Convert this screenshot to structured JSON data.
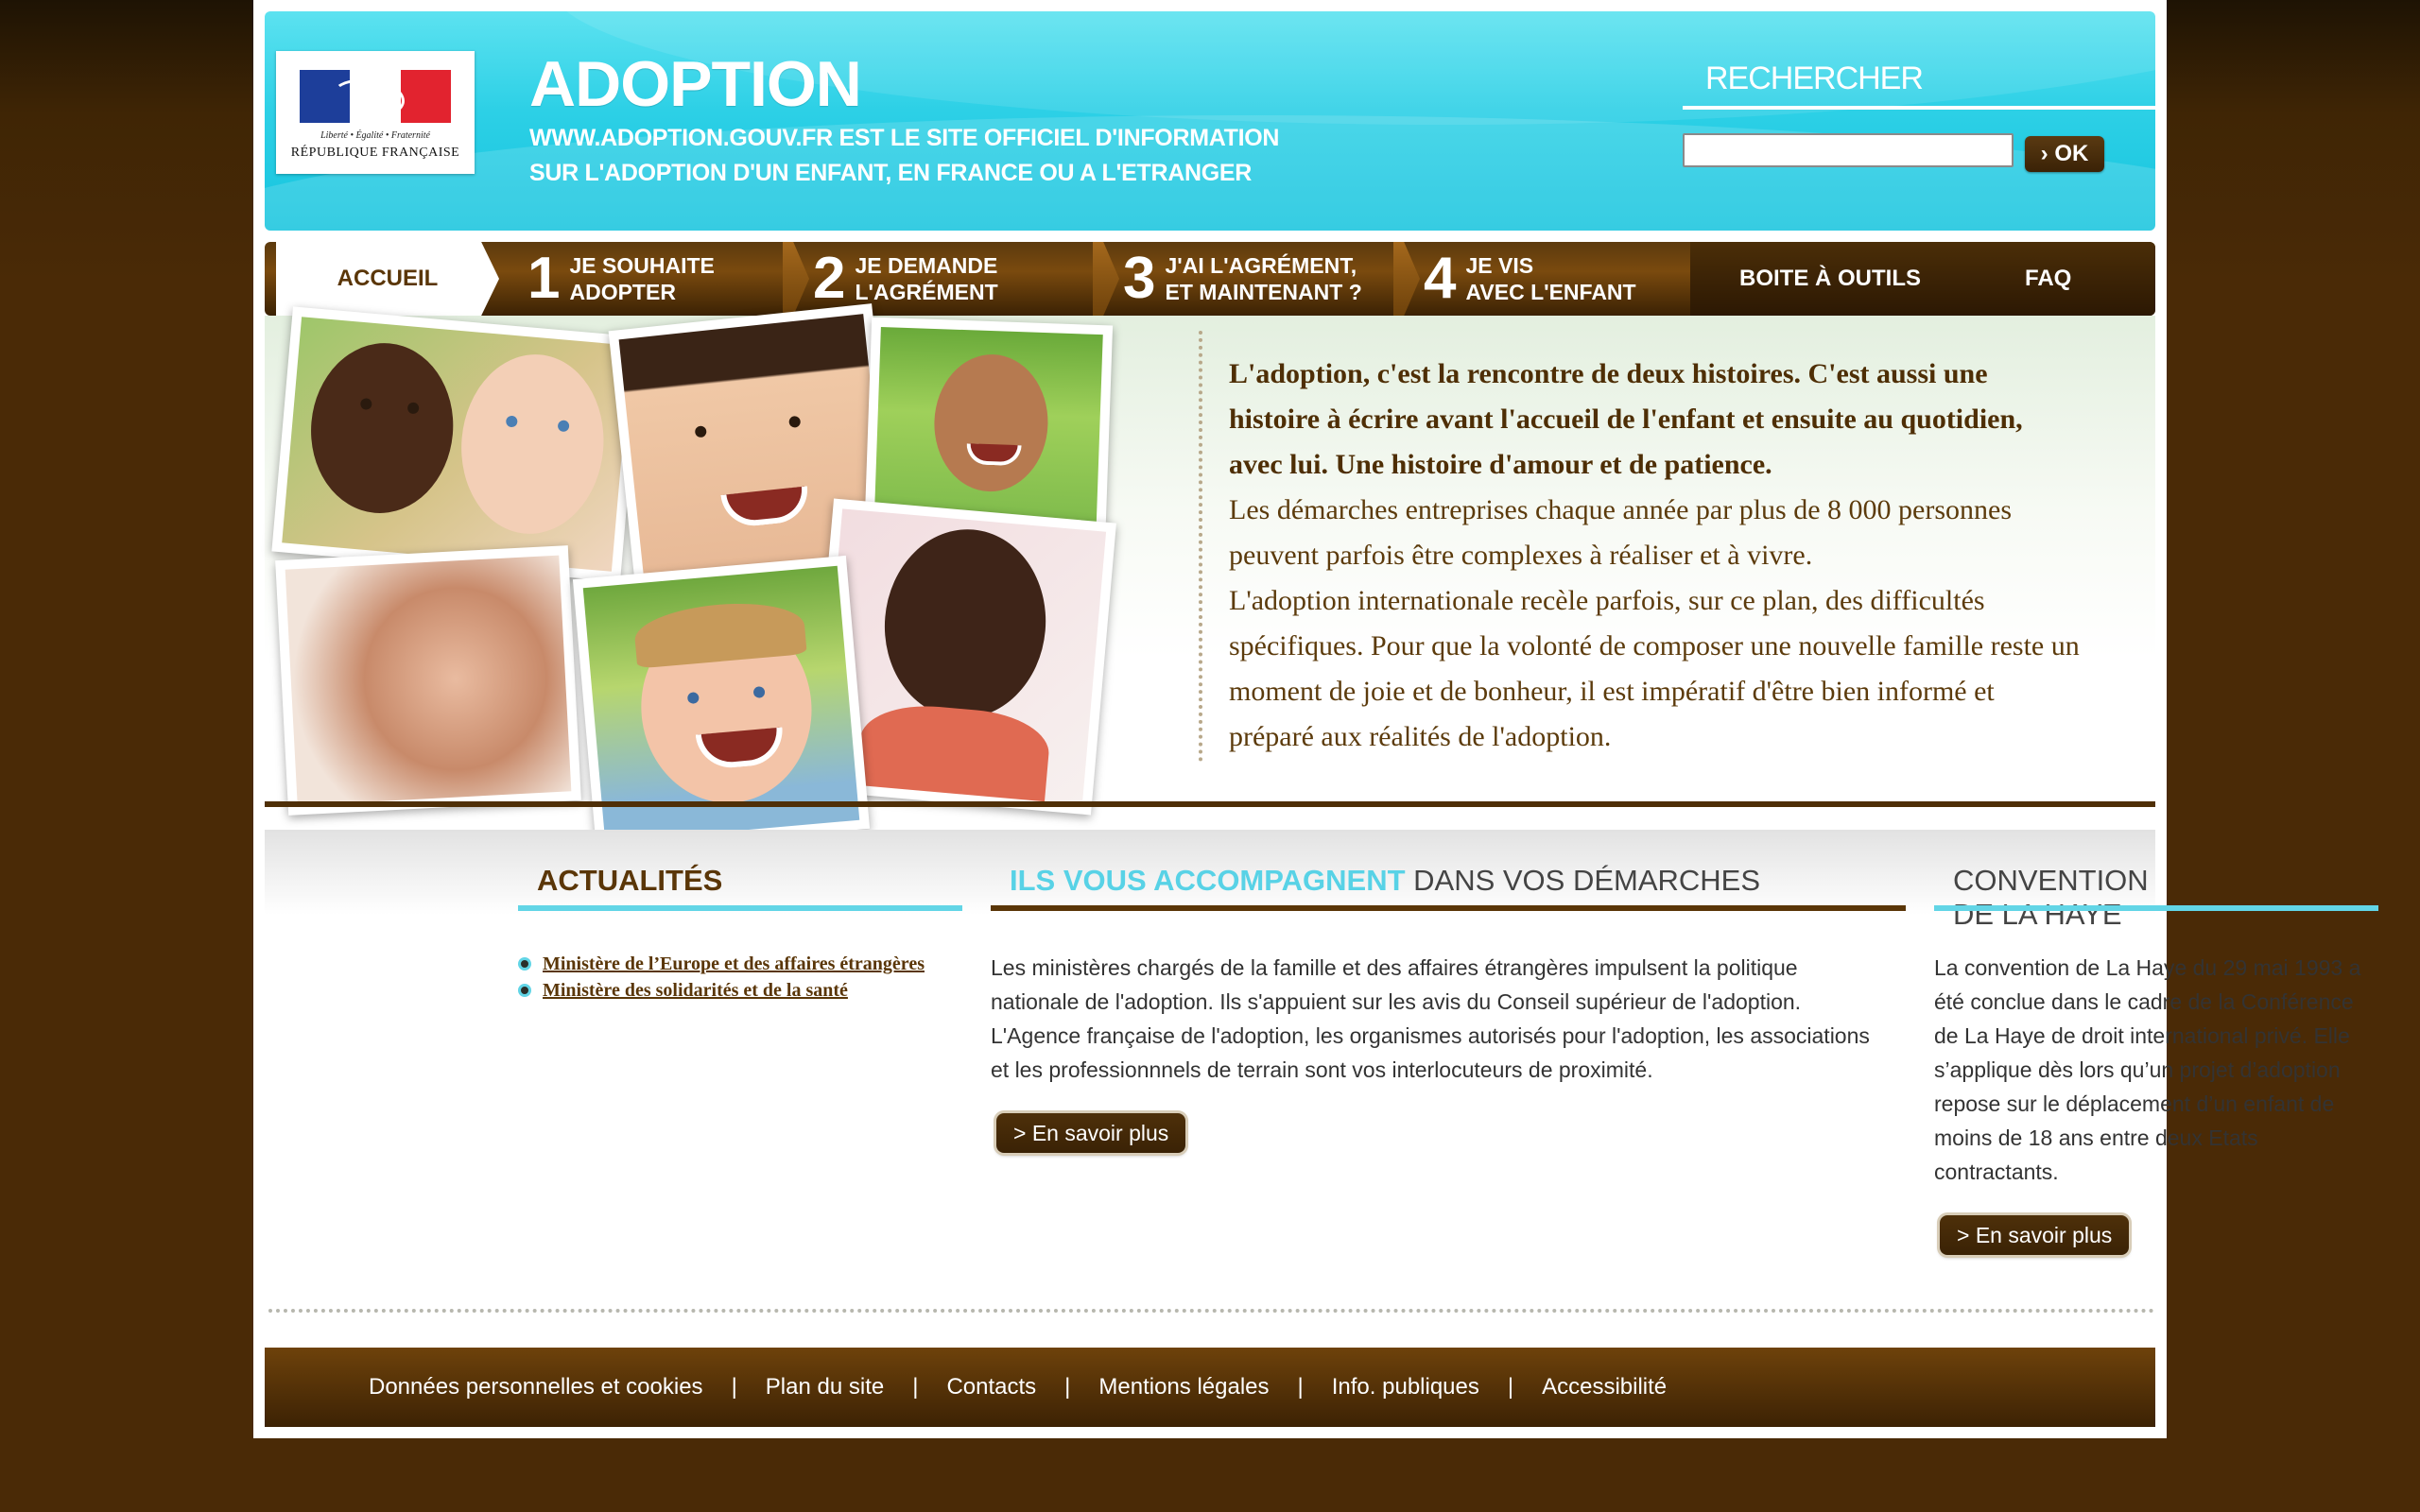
{
  "header": {
    "logo_motto": "Liberté • Égalité • Fraternité",
    "logo_republic": "RÉPUBLIQUE FRANÇAISE",
    "title": "ADOPTION",
    "subtitle_line1": "WWW.ADOPTION.GOUV.FR EST LE SITE OFFICIEL D'INFORMATION",
    "subtitle_line2": "SUR L'ADOPTION D'UN ENFANT, EN FRANCE OU A L'ETRANGER",
    "search_title": "RECHERCHER",
    "search_value": "",
    "search_ok": "› OK"
  },
  "nav": {
    "home": "ACCUEIL",
    "steps": [
      {
        "num": "1",
        "label": "JE SOUHAITE\nADOPTER"
      },
      {
        "num": "2",
        "label": "JE DEMANDE\nL'AGRÉMENT"
      },
      {
        "num": "3",
        "label": "J'AI L'AGRÉMENT,\nET MAINTENANT ?"
      },
      {
        "num": "4",
        "label": "JE VIS\nAVEC L'ENFANT"
      }
    ],
    "tools": "BOITE À OUTILS",
    "faq": "FAQ"
  },
  "intro": {
    "lead": "L'adoption, c'est la rencontre de deux histoires. C'est aussi une histoire à écrire avant l'accueil de l'enfant et ensuite au quotidien, avec lui. Une histoire d'amour et de patience.",
    "p1": "Les démarches entreprises chaque année par plus de 8 000 personnes peuvent parfois être complexes à réaliser et à vivre.",
    "p2": "L'adoption internationale recèle parfois, sur ce plan, des difficultés spécifiques. Pour que la volonté de composer une nouvelle famille reste un moment de joie et de bonheur, il est impératif d'être bien informé et préparé aux réalités de l'adoption."
  },
  "news": {
    "title": "ACTUALITÉS",
    "links": [
      "Ministère de l’Europe et des affaires étrangères",
      "Ministère des solidarités et de la santé"
    ]
  },
  "accompany": {
    "title_highlight": "ILS VOUS ACCOMPAGNENT",
    "title_rest": " DANS VOS DÉMARCHES",
    "text": "Les ministères chargés de la famille et des affaires étrangères impulsent la politique nationale de l'adoption. Ils s'appuient sur les avis du Conseil supérieur de l'adoption. L'Agence française de l'adoption, les organismes autorisés pour l'adoption, les associations et les professionnnels de terrain sont vos interlocuteurs de proximité.",
    "button": "> En savoir plus"
  },
  "haye": {
    "title": "CONVENTION DE LA HAYE",
    "text": "La convention de La Haye du 29 mai 1993 a été conclue dans le cadre de la Conférence de La Haye de droit international privé. Elle s’applique dès lors qu’un projet d’adoption repose sur le déplacement d’un enfant de moins de 18 ans entre deux Etats contractants.",
    "button": "> En savoir plus"
  },
  "footer": {
    "links": [
      "Données personnelles et cookies",
      "Plan du site",
      "Contacts",
      "Mentions légales",
      "Info. publiques",
      "Accessibilité"
    ],
    "separator": "|"
  },
  "colors": {
    "cyan": "#2dd0e6",
    "brown": "#5a3608",
    "accent_line": "#62d5e6"
  }
}
